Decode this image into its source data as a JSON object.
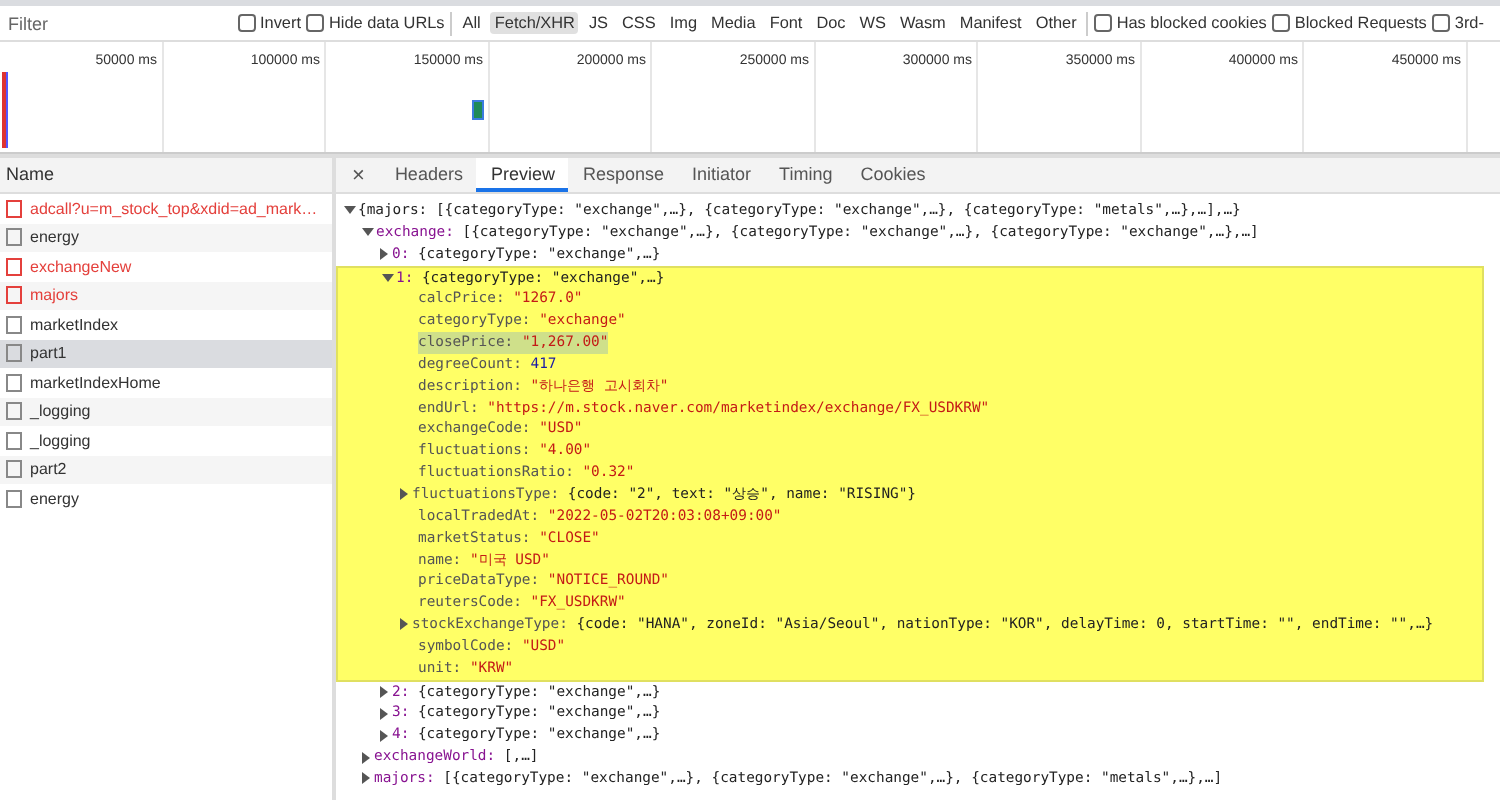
{
  "filter_bar": {
    "filter": {
      "placeholder": "Filter"
    },
    "options": [
      {
        "label": "Invert",
        "checked": false
      },
      {
        "label": "Hide data URLs",
        "checked": false
      }
    ],
    "types": [
      {
        "label": "All",
        "selected": false
      },
      {
        "label": "Fetch/XHR",
        "selected": true
      },
      {
        "label": "JS",
        "selected": false
      },
      {
        "label": "CSS",
        "selected": false
      },
      {
        "label": "Img",
        "selected": false
      },
      {
        "label": "Media",
        "selected": false
      },
      {
        "label": "Font",
        "selected": false
      },
      {
        "label": "Doc",
        "selected": false
      },
      {
        "label": "WS",
        "selected": false
      },
      {
        "label": "Wasm",
        "selected": false
      },
      {
        "label": "Manifest",
        "selected": false
      },
      {
        "label": "Other",
        "selected": false
      }
    ],
    "blocking": [
      {
        "label": "Has blocked cookies",
        "checked": false
      },
      {
        "label": "Blocked Requests",
        "checked": false
      },
      {
        "label": "3rd-",
        "checked": false
      }
    ]
  },
  "timeline": {
    "ticks": [
      "50000 ms",
      "100000 ms",
      "150000 ms",
      "200000 ms",
      "250000 ms",
      "300000 ms",
      "350000 ms",
      "400000 ms",
      "450000 ms"
    ]
  },
  "requests": {
    "column": "Name",
    "rows": [
      {
        "name": "adcall?u=m_stock_top&xdid=ad_mark…",
        "failed": true,
        "selected": false
      },
      {
        "name": "energy",
        "failed": false,
        "selected": false
      },
      {
        "name": "exchangeNew",
        "failed": true,
        "selected": false
      },
      {
        "name": "majors",
        "failed": true,
        "selected": false
      },
      {
        "name": "marketIndex",
        "failed": false,
        "selected": false
      },
      {
        "name": "part1",
        "failed": false,
        "selected": true
      },
      {
        "name": "marketIndexHome",
        "failed": false,
        "selected": false
      },
      {
        "name": "_logging",
        "failed": false,
        "selected": false
      },
      {
        "name": "_logging",
        "failed": false,
        "selected": false
      },
      {
        "name": "part2",
        "failed": false,
        "selected": false
      },
      {
        "name": "energy",
        "failed": false,
        "selected": false
      }
    ]
  },
  "detail_tabs": {
    "close": "×",
    "tabs": [
      {
        "label": "Headers",
        "selected": false
      },
      {
        "label": "Preview",
        "selected": true
      },
      {
        "label": "Response",
        "selected": false
      },
      {
        "label": "Initiator",
        "selected": false
      },
      {
        "label": "Timing",
        "selected": false
      },
      {
        "label": "Cookies",
        "selected": false
      }
    ]
  },
  "preview": [
    {
      "value": "{majors: [{categoryType: \"exchange\",…}, {categoryType: \"exchange\",…}, {categoryType: \"metals\",…},…],…}",
      "kind": "object",
      "expanded": true,
      "children": [
        {
          "key": "exchange:",
          "value": "[{categoryType: \"exchange\",…}, {categoryType: \"exchange\",…}, {categoryType: \"exchange\",…},…]",
          "kind": "object",
          "expanded": true,
          "children": [
            {
              "key": "0:",
              "value": "{categoryType: \"exchange\",…}",
              "kind": "object",
              "expanded": false,
              "highlighted": false
            },
            {
              "key": "1:",
              "value": "{categoryType: \"exchange\",…}",
              "kind": "object",
              "expanded": true,
              "highlighted": true,
              "children": [
                {
                  "key": "calcPrice:",
                  "value": "\"1267.0\"",
                  "kind": "string",
                  "matched": false
                },
                {
                  "key": "categoryType:",
                  "value": "\"exchange\"",
                  "kind": "string",
                  "matched": false
                },
                {
                  "key": "closePrice:",
                  "value": "\"1,267.00\"",
                  "kind": "string",
                  "matched": true
                },
                {
                  "key": "degreeCount:",
                  "value": "417",
                  "kind": "number",
                  "matched": false
                },
                {
                  "key": "description:",
                  "value": "\"하나은행 고시회차\"",
                  "kind": "string",
                  "matched": false
                },
                {
                  "key": "endUrl:",
                  "value": "\"https://m.stock.naver.com/marketindex/exchange/FX_USDKRW\"",
                  "kind": "string",
                  "matched": false
                },
                {
                  "key": "exchangeCode:",
                  "value": "\"USD\"",
                  "kind": "string",
                  "matched": false
                },
                {
                  "key": "fluctuations:",
                  "value": "\"4.00\"",
                  "kind": "string",
                  "matched": false
                },
                {
                  "key": "fluctuationsRatio:",
                  "value": "\"0.32\"",
                  "kind": "string",
                  "matched": false
                },
                {
                  "key": "fluctuationsType:",
                  "value": "{code: \"2\", text: \"상승\", name: \"RISING\"}",
                  "kind": "object",
                  "expanded": false,
                  "matched": false
                },
                {
                  "key": "localTradedAt:",
                  "value": "\"2022-05-02T20:03:08+09:00\"",
                  "kind": "string",
                  "matched": false
                },
                {
                  "key": "marketStatus:",
                  "value": "\"CLOSE\"",
                  "kind": "string",
                  "matched": false
                },
                {
                  "key": "name:",
                  "value": "\"미국 USD\"",
                  "kind": "string",
                  "matched": false
                },
                {
                  "key": "priceDataType:",
                  "value": "\"NOTICE_ROUND\"",
                  "kind": "string",
                  "matched": false
                },
                {
                  "key": "reutersCode:",
                  "value": "\"FX_USDKRW\"",
                  "kind": "string",
                  "matched": false
                },
                {
                  "key": "stockExchangeType:",
                  "value": "{code: \"HANA\", zoneId: \"Asia/Seoul\", nationType: \"KOR\", delayTime: 0, startTime: \"\", endTime: \"\",…}",
                  "kind": "object",
                  "expanded": false,
                  "matched": false
                },
                {
                  "key": "symbolCode:",
                  "value": "\"USD\"",
                  "kind": "string",
                  "matched": false
                },
                {
                  "key": "unit:",
                  "value": "\"KRW\"",
                  "kind": "string",
                  "matched": false
                }
              ]
            },
            {
              "key": "2:",
              "value": "{categoryType: \"exchange\",…}",
              "kind": "object",
              "expanded": false,
              "highlighted": false
            },
            {
              "key": "3:",
              "value": "{categoryType: \"exchange\",…}",
              "kind": "object",
              "expanded": false,
              "highlighted": false
            },
            {
              "key": "4:",
              "value": "{categoryType: \"exchange\",…}",
              "kind": "object",
              "expanded": false,
              "highlighted": false
            }
          ]
        },
        {
          "key": "exchangeWorld:",
          "value": "[,…]",
          "kind": "object",
          "expanded": false
        },
        {
          "key": "majors:",
          "value": "[{categoryType: \"exchange\",…}, {categoryType: \"exchange\",…}, {categoryType: \"metals\",…},…]",
          "kind": "object",
          "expanded": false
        }
      ]
    }
  ]
}
